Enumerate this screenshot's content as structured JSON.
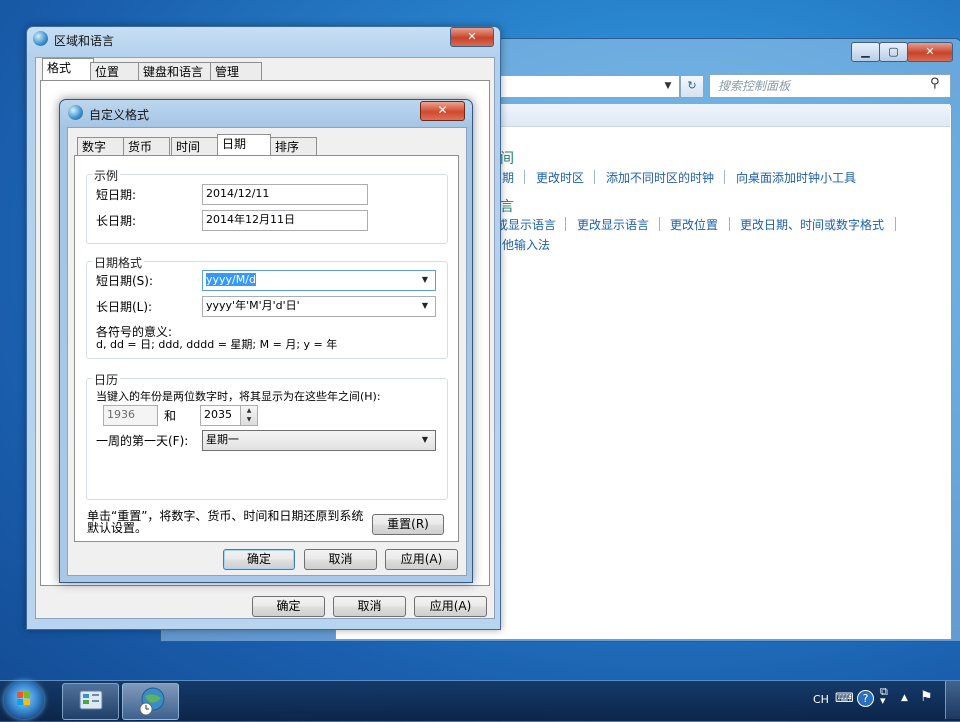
{
  "control_panel": {
    "search_placeholder": "搜索控制面板",
    "section_datetime_title_partial": "间",
    "datetime_links": [
      "期",
      "更改时区",
      "添加不同时区的时钟",
      "向桌面添加时钟小工具"
    ],
    "section_language_title_partial": "言",
    "language_links": [
      "或显示语言",
      "更改显示语言",
      "更改位置",
      "更改日期、时间或数字格式"
    ],
    "language_link_line2": "他输入法"
  },
  "region_language": {
    "title": "区域和语言",
    "tabs": [
      "格式",
      "位置",
      "键盘和语言",
      "管理"
    ],
    "buttons": {
      "ok": "确定",
      "cancel": "取消",
      "apply": "应用(A)"
    }
  },
  "custom_format": {
    "title": "自定义格式",
    "tabs": [
      "数字",
      "货币",
      "时间",
      "日期",
      "排序"
    ],
    "active_tab": "日期",
    "example": {
      "legend": "示例",
      "short_label": "短日期:",
      "short_value": "2014/12/11",
      "long_label": "长日期:",
      "long_value": "2014年12月11日"
    },
    "date_formats": {
      "legend": "日期格式",
      "short_label": "短日期(S):",
      "short_value": "yyyy/M/d",
      "long_label": "长日期(L):",
      "long_value": "yyyy'年'M'月'd'日'",
      "meaning_title": "各符号的意义:",
      "meaning_text": "d, dd = 日;  ddd, dddd = 星期;  M = 月;  y = 年"
    },
    "calendar": {
      "legend": "日历",
      "two_digit_label": "当键入的年份是两位数字时，将其显示为在这些年之间(H):",
      "year_from": "1936",
      "and_label": "和",
      "year_to": "2035",
      "first_day_label": "一周的第一天(F):",
      "first_day_value": "星期一"
    },
    "reset_text": "单击“重置”，将数字、货币、时间和日期还原到系统默认设置。",
    "reset_button": "重置(R)",
    "buttons": {
      "ok": "确定",
      "cancel": "取消",
      "apply": "应用(A)"
    }
  },
  "taskbar": {
    "input_indicator": "CH"
  }
}
